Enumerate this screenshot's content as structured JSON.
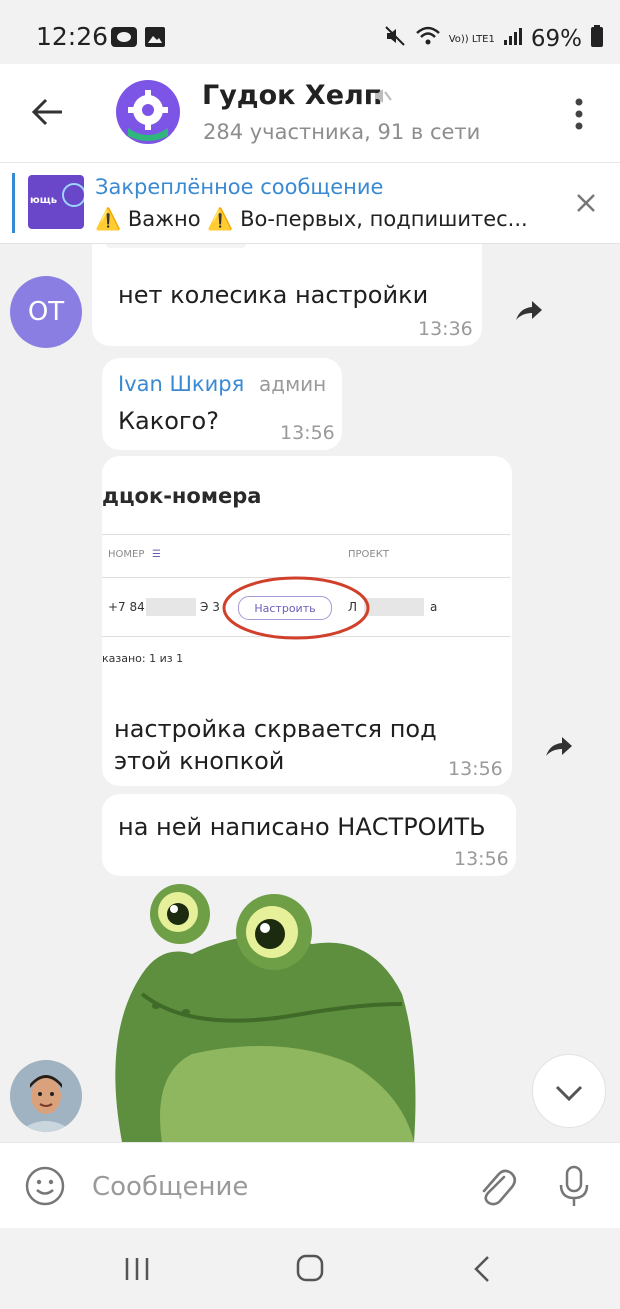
{
  "status_bar": {
    "time": "12:26",
    "battery": "69%",
    "network": "Vo)) LTE1"
  },
  "header": {
    "title": "Гудок Хелп",
    "subtitle": "284 участника, 91 в сети"
  },
  "pinned": {
    "label": "Закреплённое сообщение",
    "text": "⚠️ Важно ⚠️  Во-первых, подпишитес...",
    "thumb_text": "ющь"
  },
  "messages": [
    {
      "avatar_initials": "ОТ",
      "text": "нет колесика настройки",
      "time": "13:36"
    },
    {
      "author": "Ivan Шкиря",
      "role": "админ",
      "text": "Какого?",
      "time": "13:56"
    },
    {
      "image": {
        "title": "дцок-номера",
        "col_number": "НОМЕР",
        "col_project": "ПРОЕКТ",
        "phone": "+7 84",
        "phone_mid": "Э 3",
        "button": "Настроить",
        "project_start": "Л",
        "project_end": "а",
        "count": "казано: 1 из 1"
      },
      "text_line1": "настройка скрвается под",
      "text_line2": "этой кнопкой",
      "time": "13:56"
    },
    {
      "text": "на ней написано НАСТРОИТЬ",
      "time": "13:56"
    }
  ],
  "input": {
    "placeholder": "Сообщение"
  },
  "colors": {
    "accent": "#3a8ad3",
    "group_avatar": "#7d55e6",
    "user_avatar": "#8a7ee2",
    "frog": "#5e8f3e"
  }
}
